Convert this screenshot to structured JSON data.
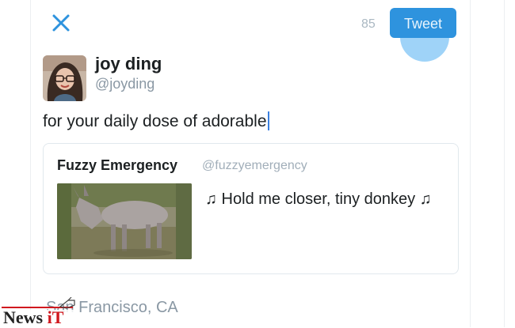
{
  "compose": {
    "close_icon": "close-icon",
    "char_count": "85",
    "tweet_label": "Tweet",
    "text": "for your daily dose of adorable"
  },
  "user": {
    "name": "joy ding",
    "handle": "@joyding"
  },
  "quoted": {
    "name": "Fuzzy Emergency",
    "handle": "@fuzzyemergency",
    "text": "♫ Hold me closer, tiny donkey ♫"
  },
  "location": "San Francisco, CA",
  "watermark": {
    "brand": "News ",
    "brand_accent": "iT"
  },
  "colors": {
    "accent": "#2e93de",
    "muted": "#8a98a4",
    "border": "#e1e8ed"
  }
}
